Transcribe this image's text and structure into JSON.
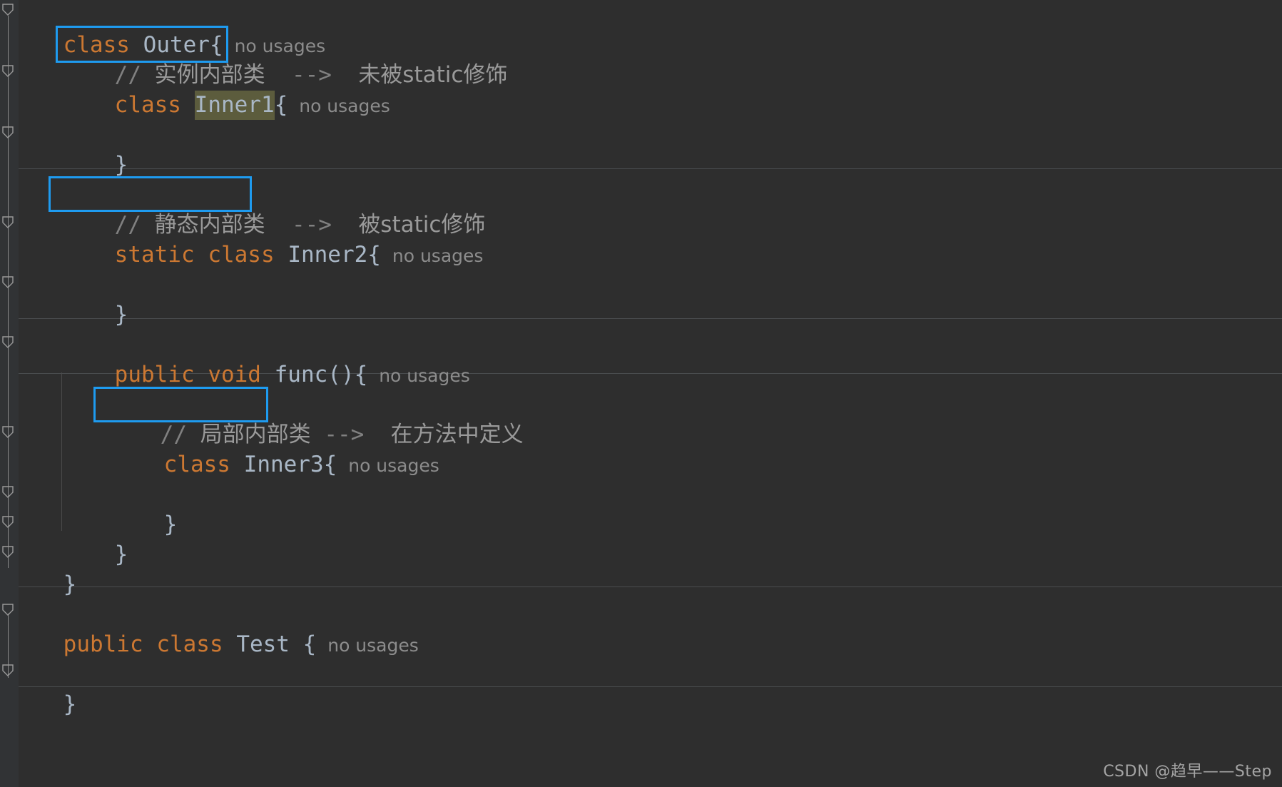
{
  "editor": {
    "background": "#2e2e2e",
    "gutter_background": "#313335",
    "accent_box_color": "#1e9bf0",
    "keyword_color": "#cc7832",
    "identifier_color": "#a9b7c6",
    "comment_color": "#808080",
    "usages_color": "#8c8c8c",
    "selection_highlight_color": "#5c5c3d",
    "separator_color": "#4a4d4f"
  },
  "code": {
    "line1": {
      "kw_class": "class",
      "name": "Outer",
      "brace": "{",
      "usages": "no usages"
    },
    "line2": {
      "comment_slashes": "// ",
      "comment_cn": "实例内部类",
      "arrow": "-->",
      "note_cn": "未被static修饰"
    },
    "line3": {
      "kw_class": "class",
      "name": "Inner1",
      "brace": "{",
      "usages": "no usages"
    },
    "line4": {
      "brace": "}"
    },
    "line5": {
      "comment_slashes": "// ",
      "comment_cn": "静态内部类",
      "arrow": "-->",
      "note_cn": "被static修饰"
    },
    "line6": {
      "kw_static": "static",
      "kw_class": "class",
      "name": "Inner2",
      "brace": "{",
      "usages": "no usages"
    },
    "line7": {
      "brace": "}"
    },
    "line8": {
      "kw_public": "public",
      "kw_void": "void",
      "name": "func",
      "parens": "()",
      "brace": "{",
      "usages": "no usages"
    },
    "line9": {
      "comment_slashes": "// ",
      "comment_cn": "局部内部类",
      "arrow": "-->",
      "note_cn": "在方法中定义"
    },
    "line10": {
      "kw_class": "class",
      "name": "Inner3",
      "brace": "{",
      "usages": "no usages"
    },
    "line11": {
      "brace": "}"
    },
    "line12": {
      "brace": "}"
    },
    "line13": {
      "brace": "}"
    },
    "line14": {
      "kw_public": "public",
      "kw_class": "class",
      "name": "Test",
      "brace": "{",
      "usages": "no usages"
    },
    "line15": {
      "brace": "}"
    }
  },
  "watermark": {
    "text": "CSDN @趋早——Step"
  }
}
